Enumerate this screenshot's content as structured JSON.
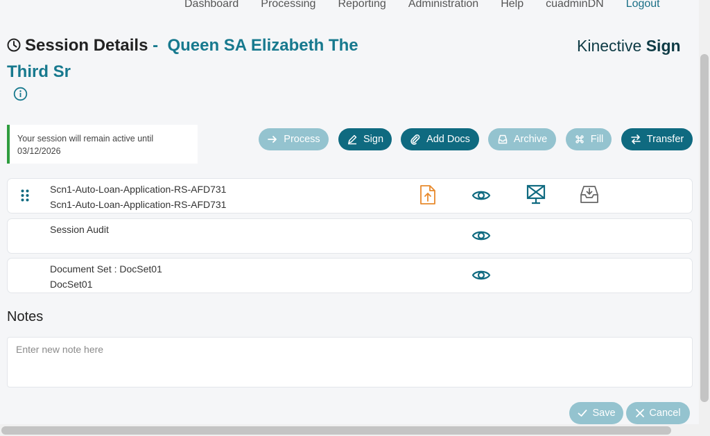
{
  "nav": {
    "items": [
      "Dashboard",
      "Processing",
      "Reporting",
      "Administration",
      "Help",
      "cuadminDN"
    ],
    "logout": "Logout"
  },
  "header": {
    "title": "Session Details",
    "separator": "-",
    "session_name": "Queen SA Elizabeth The Third Sr"
  },
  "brand": {
    "part1": "Kinective",
    "part2": "Sign"
  },
  "session_notice": "Your session will remain active until 03/12/2026",
  "actions": {
    "process": "Process",
    "sign": "Sign",
    "add_docs": "Add Docs",
    "archive": "Archive",
    "fill": "Fill",
    "transfer": "Transfer"
  },
  "documents": [
    {
      "line1": "Scn1-Auto-Loan-Application-RS-AFD731",
      "line2": "Scn1-Auto-Loan-Application-RS-AFD731"
    },
    {
      "line1": "Session Audit",
      "line2": ""
    },
    {
      "line1": "Document Set : DocSet01",
      "line2": "DocSet01"
    }
  ],
  "notes": {
    "label": "Notes",
    "placeholder": "Enter new note here"
  },
  "footer": {
    "save": "Save",
    "cancel": "Cancel"
  },
  "colors": {
    "accent": "#0f6a80",
    "accent_light": "#94c3cf",
    "title_teal": "#17798e",
    "upload_orange": "#e8892b",
    "active_green": "#2e9c3f"
  }
}
